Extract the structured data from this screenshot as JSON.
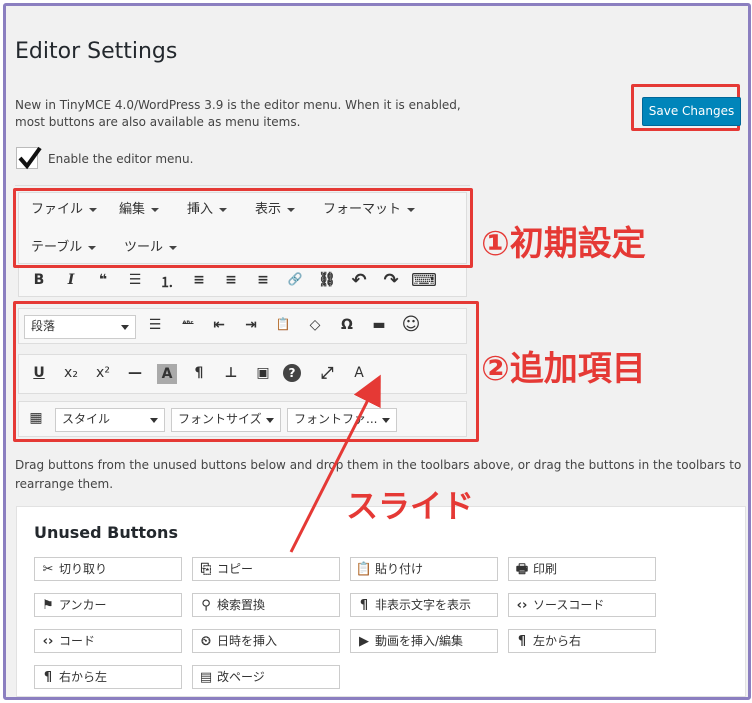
{
  "page": {
    "title": "Editor Settings"
  },
  "settings": {
    "description_line1": "New in TinyMCE 4.0/WordPress 3.9 is the editor menu. When it is enabled,",
    "description_line2": "most buttons are also available as menu items.",
    "enable_menu_label": "Enable the editor menu.",
    "enable_menu_checked": true,
    "save_label": "Save Changes"
  },
  "menubar": {
    "items_row1": [
      "ファイル",
      "編集",
      "挿入",
      "表示",
      "フォーマット"
    ],
    "items_row2": [
      "テーブル",
      "ツール"
    ]
  },
  "toolbar1": {
    "icons": [
      "bold-icon",
      "italic-icon",
      "blockquote-icon",
      "bullet-list-icon",
      "numbered-list-icon",
      "align-left-icon",
      "align-center-icon",
      "align-right-icon",
      "link-icon",
      "unlink-icon",
      "undo-icon",
      "redo-icon",
      "keyboard-icon"
    ],
    "glyphs": [
      "B",
      "I",
      "❝",
      "☰",
      "⒈",
      "≡",
      "≡",
      "≡",
      "🔗",
      "⛓",
      "↶",
      "↷",
      "⌨"
    ]
  },
  "toolbar2": {
    "format_select": "段落",
    "glyphs": [
      "☰",
      "ᴬᴮᶜ",
      "⇤",
      "⇥",
      "📋",
      "◇",
      "Ω",
      "▬",
      "☺"
    ]
  },
  "toolbar3": {
    "glyphs": [
      "U",
      "x₂",
      "x²",
      "—",
      "A",
      "¶",
      "⊥",
      "▣",
      "?",
      "⤢",
      "A"
    ]
  },
  "toolbar4": {
    "style_select": "スタイル",
    "fontsize_select": "フォントサイズ",
    "fontfamily_select": "フォントファ..."
  },
  "annotations": {
    "label1": "①初期設定",
    "label2": "②追加項目",
    "label3": "スライド"
  },
  "drag_text_line1": "Drag buttons from the unused buttons below and drop them in the toolbars above, or drag the buttons in the toolbars to",
  "drag_text_line2": "rearrange them.",
  "unused": {
    "title": "Unused Buttons",
    "buttons": [
      {
        "label": "切り取り",
        "icon": "✂"
      },
      {
        "label": "コピー",
        "icon": "⎘"
      },
      {
        "label": "貼り付け",
        "icon": "📋"
      },
      {
        "label": "印刷",
        "icon": "🖶"
      },
      {
        "label": "アンカー",
        "icon": "⚑"
      },
      {
        "label": "検索置換",
        "icon": "⚲"
      },
      {
        "label": "非表示文字を表示",
        "icon": "¶"
      },
      {
        "label": "ソースコード",
        "icon": "‹›"
      },
      {
        "label": "コード",
        "icon": "‹›"
      },
      {
        "label": "日時を挿入",
        "icon": "⏲"
      },
      {
        "label": "動画を挿入/編集",
        "icon": "▶"
      },
      {
        "label": "左から右",
        "icon": "¶"
      },
      {
        "label": "右から左",
        "icon": "¶"
      },
      {
        "label": "改ページ",
        "icon": "▤"
      }
    ]
  },
  "colors": {
    "accent": "#0085ba",
    "annotation_red": "#e53935",
    "frame": "#8b7fc0"
  }
}
